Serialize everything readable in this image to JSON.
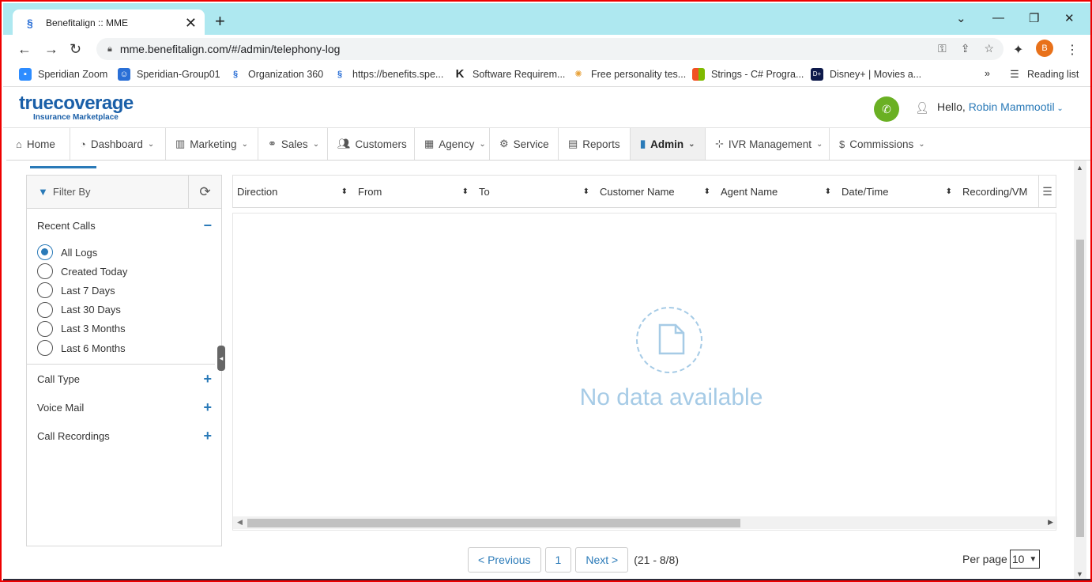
{
  "browser": {
    "tab_title": "Benefitalign :: MME",
    "tab_close": "✕",
    "new_tab": "+",
    "url": "mme.benefitalign.com/#/admin/telephony-log",
    "profile_initial": "B",
    "bookmarks": [
      {
        "label": "Speridian Zoom"
      },
      {
        "label": "Speridian-Group01"
      },
      {
        "label": "Organization 360"
      },
      {
        "label": "https://benefits.spe..."
      },
      {
        "label": "Software Requirem..."
      },
      {
        "label": "Free personality tes..."
      },
      {
        "label": "Strings - C# Progra..."
      },
      {
        "label": "Disney+ | Movies a..."
      }
    ],
    "more_bookmarks": "»",
    "reading_list": "Reading list"
  },
  "app": {
    "logo_main": "truecoverage",
    "logo_sub": "Insurance Marketplace",
    "hello": "Hello,",
    "user_name": "Robin Mammootil"
  },
  "nav": [
    {
      "label": "Home",
      "icon": "home-icon"
    },
    {
      "label": "Dashboard",
      "icon": "dashboard-icon"
    },
    {
      "label": "Marketing",
      "icon": "chart-icon"
    },
    {
      "label": "Sales",
      "icon": "handshake-icon"
    },
    {
      "label": "Customers",
      "icon": "users-icon"
    },
    {
      "label": "Agency",
      "icon": "building-icon"
    },
    {
      "label": "Service",
      "icon": "gears-icon"
    },
    {
      "label": "Reports",
      "icon": "reports-icon"
    },
    {
      "label": "Admin",
      "icon": "admin-icon"
    },
    {
      "label": "IVR Management",
      "icon": "sitemap-icon"
    },
    {
      "label": "Commissions",
      "icon": "dollar-icon"
    }
  ],
  "filter": {
    "title": "Filter By",
    "recent_calls": "Recent Calls",
    "options": [
      "All Logs",
      "Created Today",
      "Last 7 Days",
      "Last 30 Days",
      "Last 3 Months",
      "Last 6 Months"
    ],
    "selected": "All Logs",
    "sections": [
      "Call Type",
      "Voice Mail",
      "Call Recordings"
    ]
  },
  "grid": {
    "columns": [
      "Direction",
      "From",
      "To",
      "Customer Name",
      "Agent Name",
      "Date/Time",
      "Recording/VM"
    ],
    "empty_text": "No data available"
  },
  "pager": {
    "previous": "< Previous",
    "page": "1",
    "next": "Next >",
    "info": "(21 - 8/8)",
    "per_page_label": "Per page",
    "per_page_value": "10"
  },
  "colors": {
    "accent": "#2a7ab8",
    "phone_green": "#6ab023",
    "tab_bar": "#aee8f0"
  }
}
